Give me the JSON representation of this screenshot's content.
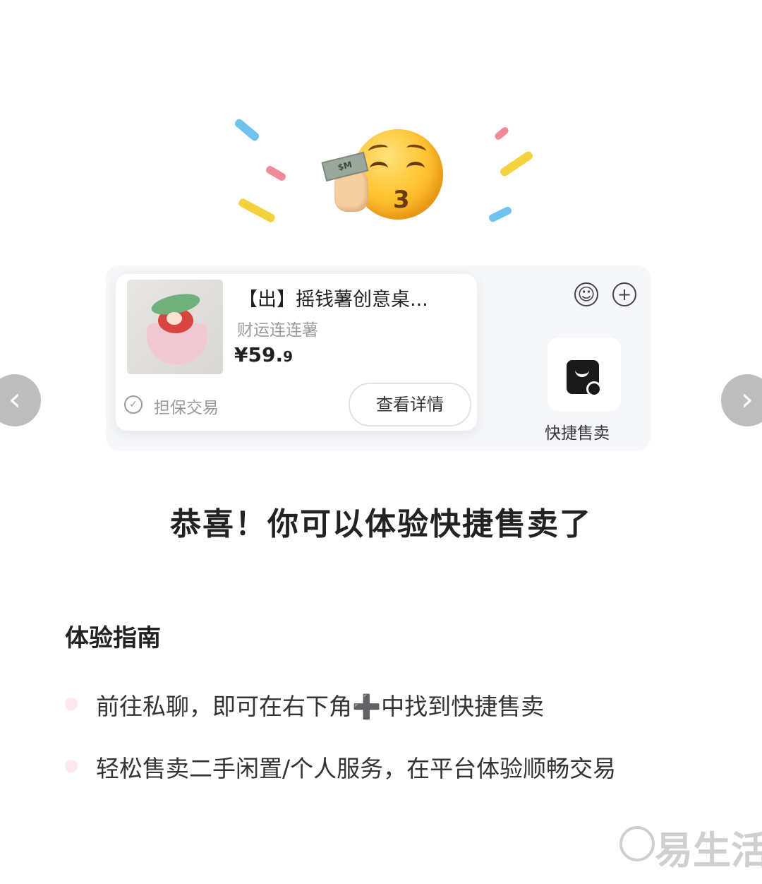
{
  "product_card": {
    "title": "【出】摇钱薯创意桌...",
    "subtitle": "财运连连薯",
    "price_symbol": "¥",
    "price_int": "59.",
    "price_dec": "9",
    "guarantee": "担保交易",
    "detail_button": "查看详情"
  },
  "quick_sell": {
    "label": "快捷售卖"
  },
  "headline": "恭喜！你可以体验快捷售卖了",
  "guide": {
    "title": "体验指南",
    "items": [
      "前往私聊，即可在右下角➕中找到快捷售卖",
      "轻松售卖二手闲置/个人服务，在平台体验顺畅交易"
    ]
  },
  "navigation": {
    "prev": "‹",
    "next": "›"
  },
  "toolbar_icons": [
    "smile-icon",
    "plus-icon"
  ],
  "watermark": {
    "text": "易生活"
  }
}
